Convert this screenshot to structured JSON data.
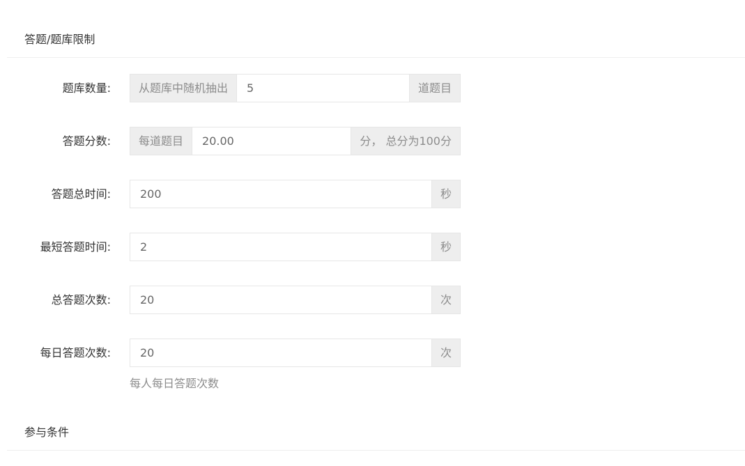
{
  "sections": {
    "limits_title": "答题/题库限制",
    "conditions_title": "参与条件"
  },
  "form": {
    "bank_count": {
      "label": "题库数量:",
      "prefix": "从题库中随机抽出",
      "value": "5",
      "suffix": "道题目"
    },
    "score": {
      "label": "答题分数:",
      "prefix": "每道题目",
      "value": "20.00",
      "suffix": "分， 总分为100分"
    },
    "total_time": {
      "label": "答题总时间:",
      "value": "200",
      "suffix": "秒"
    },
    "min_time": {
      "label": "最短答题时间:",
      "value": "2",
      "suffix": "秒"
    },
    "total_attempts": {
      "label": "总答题次数:",
      "value": "20",
      "suffix": "次"
    },
    "daily_attempts": {
      "label": "每日答题次数:",
      "value": "20",
      "suffix": "次",
      "help": "每人每日答题次数"
    }
  }
}
